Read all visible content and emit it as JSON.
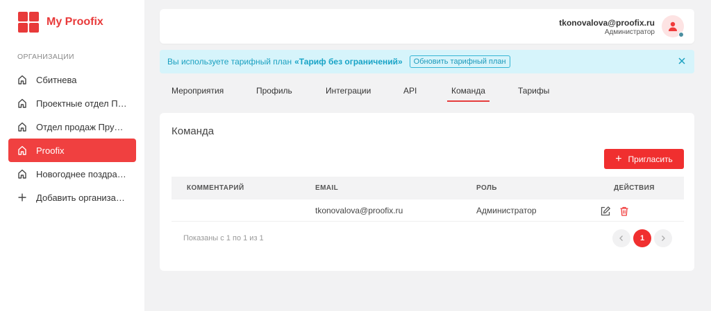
{
  "brand": {
    "name": "My Proofix",
    "color": "#e83a3a"
  },
  "sidebar": {
    "section_label": "ОРГАНИЗАЦИИ",
    "items": [
      {
        "label": "Сбитнева",
        "icon": "home-icon",
        "active": false
      },
      {
        "label": "Проектные отдел Пруфикс",
        "icon": "home-icon",
        "active": false
      },
      {
        "label": "Отдел продаж Пруфикс",
        "icon": "home-icon",
        "active": false
      },
      {
        "label": "Proofix",
        "icon": "home-icon",
        "active": true
      },
      {
        "label": "Новогоднее поздравление",
        "icon": "home-icon",
        "active": false
      },
      {
        "label": "Добавить организацию",
        "icon": "plus-icon",
        "active": false
      }
    ]
  },
  "header": {
    "user_email": "tkonovalova@proofix.ru",
    "user_role": "Администратор",
    "avatar_icon": "user-icon"
  },
  "alert": {
    "text": "Вы используете тарифный план",
    "plan": "«Тариф без ограничений»",
    "upgrade_label": "Обновить тарифный план",
    "close_icon": "close-icon"
  },
  "tabs": [
    {
      "label": "Мероприятия",
      "active": false
    },
    {
      "label": "Профиль",
      "active": false
    },
    {
      "label": "Интеграции",
      "active": false
    },
    {
      "label": "API",
      "active": false
    },
    {
      "label": "Команда",
      "active": true
    },
    {
      "label": "Тарифы",
      "active": false
    }
  ],
  "team": {
    "title": "Команда",
    "invite_label": "Пригласить",
    "columns": [
      "КОММЕНТАРИЙ",
      "EMAIL",
      "РОЛЬ",
      "ДЕЙСТВИЯ"
    ],
    "rows": [
      {
        "comment": "",
        "email": "tkonovalova@proofix.ru",
        "role": "Администратор"
      }
    ],
    "pagination_info": "Показаны с 1 по 1 из 1",
    "current_page": "1"
  },
  "colors": {
    "accent": "#f02f2f",
    "alert_bg": "#d6f4fb",
    "alert_text": "#1aa0c0"
  }
}
